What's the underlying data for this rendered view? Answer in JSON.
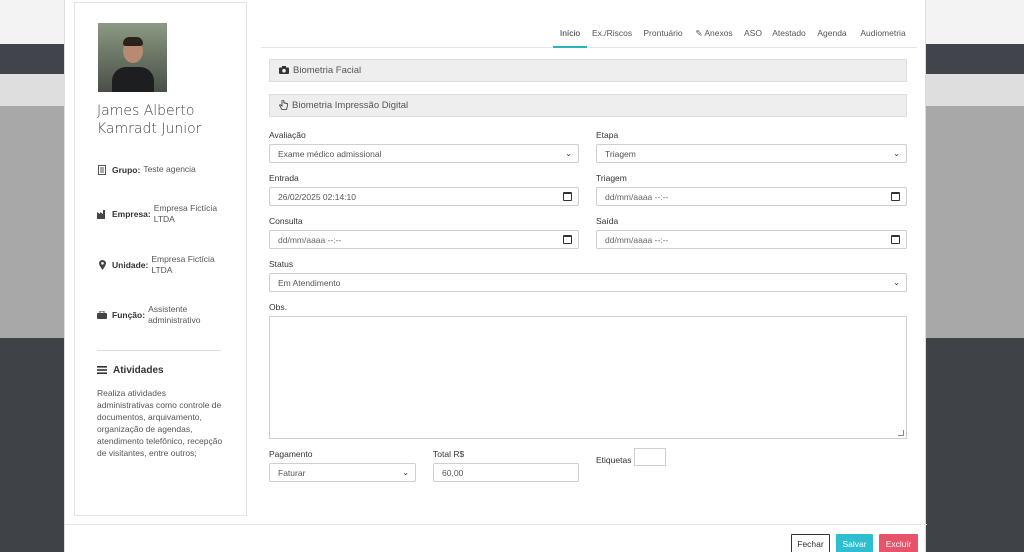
{
  "profile": {
    "name_line1": "James Alberto",
    "name_line2": "Kamradt Junior",
    "grupo_label": "Grupo:",
    "grupo_value": "Teste agencia",
    "empresa_label": "Empresa:",
    "empresa_value_l1": "Empresa Fictícia",
    "empresa_value_l2": "LTDA",
    "unidade_label": "Unidade:",
    "unidade_value_l1": "Empresa Fictícia",
    "unidade_value_l2": "LTDA",
    "funcao_label": "Função:",
    "funcao_value_l1": "Assistente",
    "funcao_value_l2": "administrativo",
    "atividades_title": "Atividades",
    "atividades_text": "Realiza atividades administrativas como controle de documentos, arquivamento, organização de agendas, atendimento telefônico, recepção de visitantes, entre outros;"
  },
  "tabs": {
    "inicio": "Início",
    "exriscos": "Ex./Riscos",
    "prontuario": "Prontuário",
    "anexos": "✎ Anexos",
    "aso": "ASO",
    "atestado": "Atestado",
    "agenda": "Agenda",
    "audiometria": "Audiometria"
  },
  "sections": {
    "biometria_facial": "Biometria Facial",
    "biometria_digital": "Biometria Impressão Digital"
  },
  "form": {
    "avaliacao_label": "Avaliação",
    "avaliacao_value": "Exame médico admissional",
    "etapa_label": "Etapa",
    "etapa_value": "Triagem",
    "entrada_label": "Entrada",
    "entrada_value": "26/02/2025 02:14:10",
    "triagem_label": "Triagem",
    "triagem_placeholder": "dd/mm/aaaa --:--",
    "consulta_label": "Consulta",
    "consulta_placeholder": "dd/mm/aaaa --:--",
    "saida_label": "Saída",
    "saida_placeholder": "dd/mm/aaaa --:--",
    "status_label": "Status",
    "status_value": "Em Atendimento",
    "obs_label": "Obs.",
    "pagamento_label": "Pagamento",
    "pagamento_value": "Faturar",
    "total_label": "Total R$",
    "total_value": "60,00",
    "etiquetas_label": "Etiquetas"
  },
  "buttons": {
    "fechar": "Fechar",
    "salvar": "Salvar",
    "excluir": "Excluir"
  }
}
